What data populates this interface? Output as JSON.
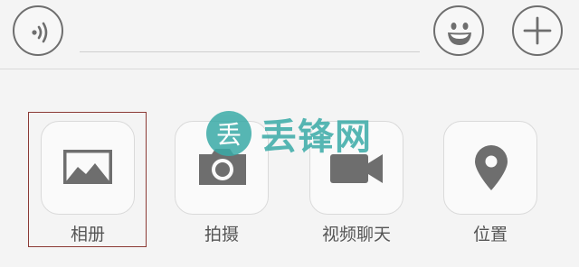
{
  "input_bar": {
    "voice_icon": "voice-wave-icon",
    "emoji_icon": "smiley-face-icon",
    "plus_icon": "plus-icon",
    "text_value": "",
    "placeholder": ""
  },
  "panel": {
    "tools": [
      {
        "label": "相册",
        "icon": "image-icon",
        "selected": true
      },
      {
        "label": "拍摄",
        "icon": "camera-icon"
      },
      {
        "label": "视频聊天",
        "icon": "video-camera-icon"
      },
      {
        "label": "位置",
        "icon": "location-pin-icon"
      }
    ]
  },
  "watermark": {
    "glyph": "丢",
    "text": "丢锋网"
  },
  "colors": {
    "icon_gray": "#6e6e6e",
    "selection_border": "#8b3a35",
    "watermark_teal": "#3aaba7",
    "background": "#f4f4f4"
  }
}
